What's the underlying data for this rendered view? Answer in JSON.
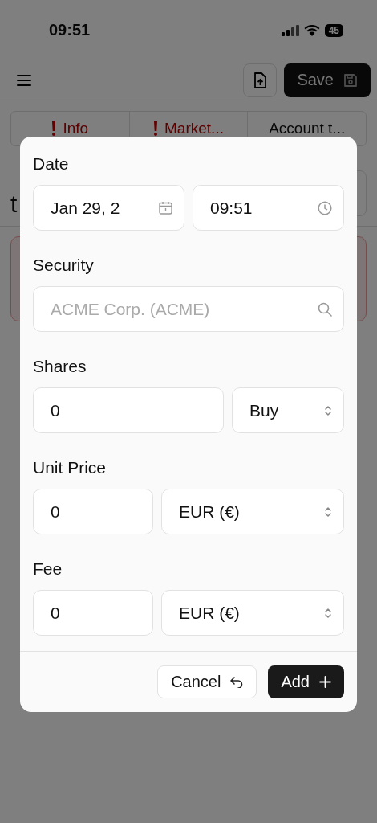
{
  "status_bar": {
    "time": "09:51",
    "battery": "45"
  },
  "header": {
    "save_label": "Save"
  },
  "tabs": [
    {
      "label": "Info",
      "error": true
    },
    {
      "label": "Market...",
      "error": true
    },
    {
      "label": "Account t...",
      "error": false
    }
  ],
  "background": {
    "heading_lines": [
      "t"
    ]
  },
  "dialog": {
    "sections": [
      {
        "label": "Date",
        "controls": [
          {
            "kind": "date",
            "value": "Jan 29, 2"
          },
          {
            "kind": "time",
            "value": "09:51"
          }
        ]
      },
      {
        "label": "Security",
        "controls": [
          {
            "kind": "search",
            "placeholder": "ACME Corp. (ACME)"
          }
        ]
      },
      {
        "label": "Shares",
        "controls": [
          {
            "kind": "number",
            "value": "0"
          },
          {
            "kind": "type_select",
            "value": "Buy"
          }
        ]
      },
      {
        "label": "Unit Price",
        "controls": [
          {
            "kind": "number",
            "value": "0"
          },
          {
            "kind": "currency_select",
            "value": "EUR (€)"
          }
        ]
      },
      {
        "label": "Fee",
        "controls": [
          {
            "kind": "number",
            "value": "0"
          },
          {
            "kind": "currency_select",
            "value": "EUR (€)"
          }
        ]
      }
    ],
    "cancel_label": "Cancel",
    "add_label": "Add"
  }
}
